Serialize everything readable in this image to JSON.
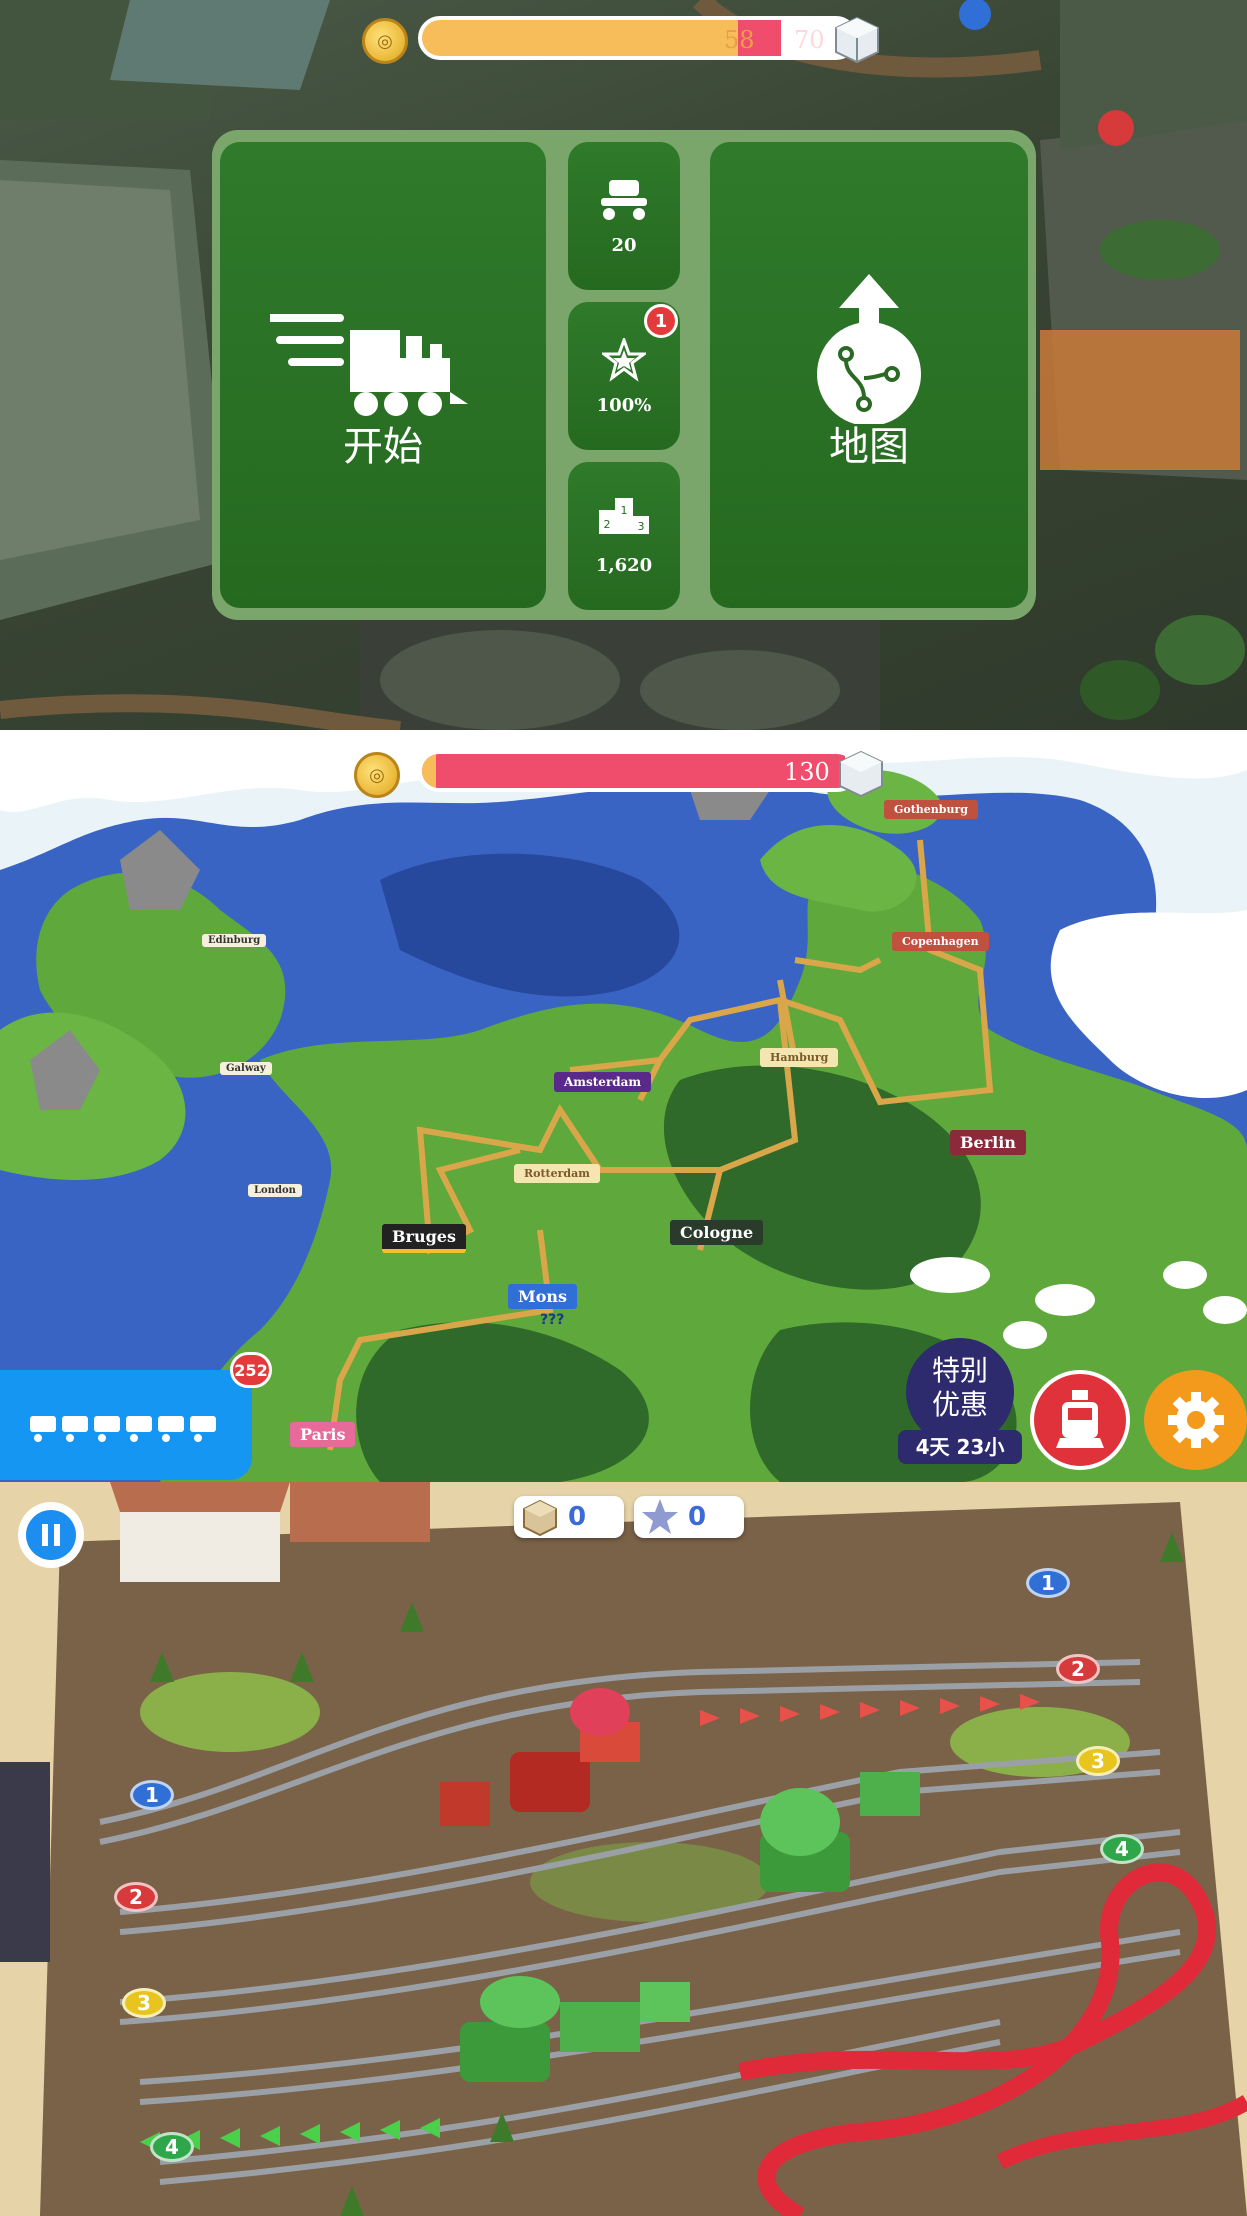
{
  "panels": {
    "start_menu": {
      "hud": {
        "progress_value": "58",
        "progress_max": "70",
        "progress_fraction": 0.83
      },
      "start_button": {
        "label": "开始",
        "icon": "train-speed-icon"
      },
      "stats": [
        {
          "icon": "seat-icon",
          "value": "20"
        },
        {
          "icon": "star-icon",
          "value": "100%",
          "badge": "1"
        },
        {
          "icon": "podium-icon",
          "value": "1,620",
          "podium": [
            "1",
            "2",
            "3"
          ]
        }
      ],
      "map_button": {
        "label": "地图",
        "icon": "route-map-icon"
      }
    },
    "world_map": {
      "hud": {
        "progress_value": "130",
        "progress_fraction": 0.98
      },
      "cities": {
        "gothenburg": "Gothenburg",
        "copenhagen": "Copenhagen",
        "edinburg": "Edinburg",
        "hamburg": "Hamburg",
        "galway": "Galway",
        "amsterdam": "Amsterdam",
        "berlin": "Berlin",
        "london": "London",
        "rotterdam": "Rotterdam",
        "bruges": "Bruges",
        "cologne": "Cologne",
        "mons": "Mons",
        "paris": "Paris"
      },
      "mons_sub": "???",
      "garage_button": {
        "badge": "252",
        "icon": "train-cars-icon"
      },
      "special_offer": {
        "line1": "特别",
        "line2": "优惠",
        "timer": "4天 23小"
      },
      "train_button": {
        "icon": "locomotive-icon"
      },
      "settings_button": {
        "icon": "gear-icon"
      }
    },
    "rail_yard": {
      "pause_icon": "pause-icon",
      "counters": [
        {
          "icon": "crate-icon",
          "value": "0"
        },
        {
          "icon": "star-icon",
          "value": "0"
        }
      ],
      "left_lanes": [
        "1",
        "2",
        "3",
        "4"
      ],
      "right_lanes": [
        "1",
        "2",
        "3",
        "4"
      ],
      "colors": {
        "lane1": "#2f6fd6",
        "lane2": "#d63a3a",
        "lane3": "#e8c51c",
        "lane4": "#2fa64a"
      }
    }
  }
}
